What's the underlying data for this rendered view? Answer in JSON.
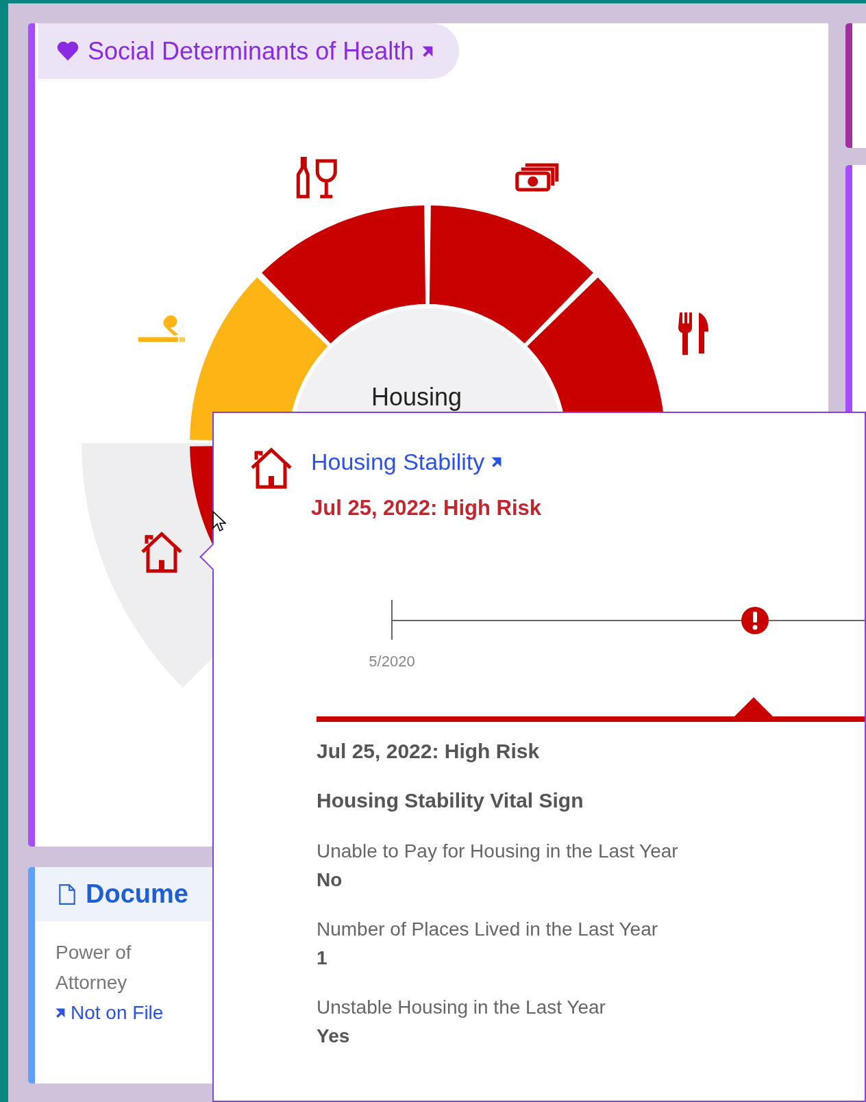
{
  "sdoh_card": {
    "title": "Social Determinants of Health",
    "chart": {
      "center_label": "Housing",
      "segments": [
        {
          "kind": "housing",
          "color": "#c80000",
          "selected": true
        },
        {
          "kind": "tobacco",
          "color": "#fdb515",
          "selected": false
        },
        {
          "kind": "alcohol",
          "color": "#c80000",
          "selected": false
        },
        {
          "kind": "financial",
          "color": "#c80000",
          "selected": false
        },
        {
          "kind": "food",
          "color": "#c80000",
          "selected": false
        }
      ]
    }
  },
  "tooltip": {
    "title": "Housing Stability",
    "status": "Jul 25, 2022: High Risk",
    "timeline": {
      "start_label": "5/2020",
      "events": [
        {
          "kind": "high_risk"
        }
      ]
    },
    "detail": {
      "heading": "Jul 25, 2022: High Risk",
      "subheading": "Housing Stability Vital Sign",
      "items": [
        {
          "question": "Unable to Pay for Housing in the Last Year",
          "answer": "No"
        },
        {
          "question": "Number of Places Lived in the Last Year",
          "answer": "1"
        },
        {
          "question": "Unstable Housing in the Last Year",
          "answer": "Yes"
        }
      ]
    }
  },
  "documents_card": {
    "title": "Docume",
    "items": [
      {
        "label": "Power of Attorney",
        "value": "Not on File"
      }
    ]
  }
}
